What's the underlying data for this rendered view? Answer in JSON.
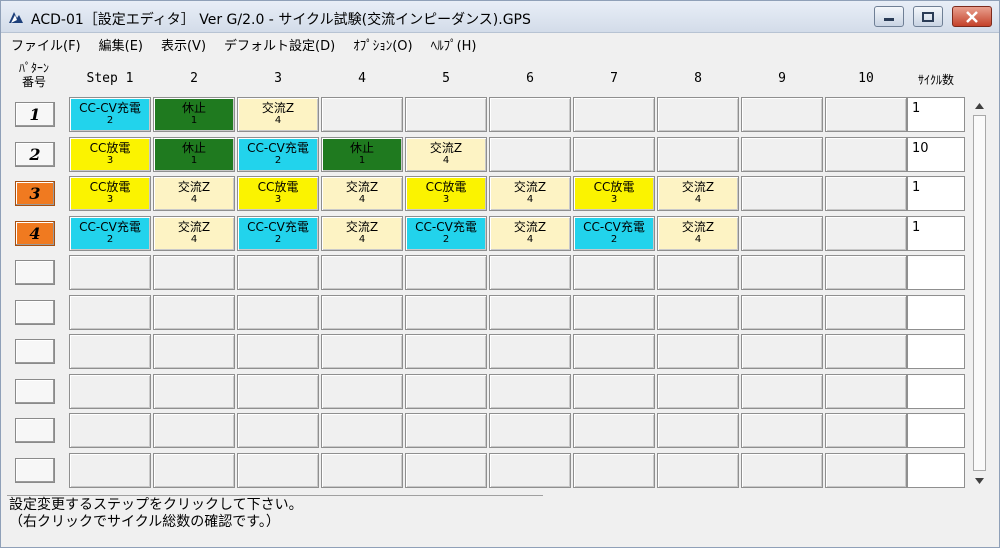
{
  "window": {
    "title": "ACD-01［設定エディタ］ Ver G/2.0 - サイクル試験(交流インピーダンス).GPS"
  },
  "menu": [
    "ファイル(F)",
    "編集(E)",
    "表示(V)",
    "デフォルト設定(D)",
    "ｵﾌﾟｼｮﾝ(O)",
    "ﾍﾙﾌﾟ(H)"
  ],
  "grid": {
    "corner_label": "ﾊﾟﾀｰﾝ\n番号",
    "columns": [
      "Step 1",
      "2",
      "3",
      "4",
      "5",
      "6",
      "7",
      "8",
      "9",
      "10"
    ],
    "cycle_header": "ｻｲｸﾙ数",
    "rows": [
      {
        "pattern": "1",
        "active": false,
        "cycles": "1",
        "cells": [
          {
            "type": "CC-CV充電",
            "num": "2",
            "color": "cyan"
          },
          {
            "type": "休止",
            "num": "1",
            "color": "green"
          },
          {
            "type": "交流Z",
            "num": "4",
            "color": "cream"
          }
        ]
      },
      {
        "pattern": "2",
        "active": false,
        "cycles": "10",
        "cells": [
          {
            "type": "CC放電",
            "num": "3",
            "color": "yellow"
          },
          {
            "type": "休止",
            "num": "1",
            "color": "green"
          },
          {
            "type": "CC-CV充電",
            "num": "2",
            "color": "cyan"
          },
          {
            "type": "休止",
            "num": "1",
            "color": "green"
          },
          {
            "type": "交流Z",
            "num": "4",
            "color": "cream"
          }
        ]
      },
      {
        "pattern": "3",
        "active": true,
        "cycles": "1",
        "cells": [
          {
            "type": "CC放電",
            "num": "3",
            "color": "yellow"
          },
          {
            "type": "交流Z",
            "num": "4",
            "color": "cream"
          },
          {
            "type": "CC放電",
            "num": "3",
            "color": "yellow"
          },
          {
            "type": "交流Z",
            "num": "4",
            "color": "cream"
          },
          {
            "type": "CC放電",
            "num": "3",
            "color": "yellow"
          },
          {
            "type": "交流Z",
            "num": "4",
            "color": "cream"
          },
          {
            "type": "CC放電",
            "num": "3",
            "color": "yellow"
          },
          {
            "type": "交流Z",
            "num": "4",
            "color": "cream"
          }
        ]
      },
      {
        "pattern": "4",
        "active": true,
        "cycles": "1",
        "cells": [
          {
            "type": "CC-CV充電",
            "num": "2",
            "color": "cyan"
          },
          {
            "type": "交流Z",
            "num": "4",
            "color": "cream"
          },
          {
            "type": "CC-CV充電",
            "num": "2",
            "color": "cyan"
          },
          {
            "type": "交流Z",
            "num": "4",
            "color": "cream"
          },
          {
            "type": "CC-CV充電",
            "num": "2",
            "color": "cyan"
          },
          {
            "type": "交流Z",
            "num": "4",
            "color": "cream"
          },
          {
            "type": "CC-CV充電",
            "num": "2",
            "color": "cyan"
          },
          {
            "type": "交流Z",
            "num": "4",
            "color": "cream"
          }
        ]
      },
      {
        "pattern": "",
        "active": false,
        "cycles": "",
        "cells": []
      },
      {
        "pattern": "",
        "active": false,
        "cycles": "",
        "cells": []
      },
      {
        "pattern": "",
        "active": false,
        "cycles": "",
        "cells": []
      },
      {
        "pattern": "",
        "active": false,
        "cycles": "",
        "cells": []
      },
      {
        "pattern": "",
        "active": false,
        "cycles": "",
        "cells": []
      },
      {
        "pattern": "",
        "active": false,
        "cycles": "",
        "cells": []
      }
    ]
  },
  "status": {
    "line1": "設定変更するステップをクリックして下さい。",
    "line2": "（右クリックでサイクル総数の確認です。）"
  },
  "colors": {
    "cyan": "#22d3ec",
    "green": "#1f7a1f",
    "yellow": "#fbf300",
    "cream": "#fdf3c4",
    "active_pattern": "#f07a20"
  },
  "icons": [
    "app-icon",
    "minimize-icon",
    "maximize-icon",
    "close-icon",
    "scroll-up-arrow-icon",
    "scroll-down-arrow-icon"
  ]
}
